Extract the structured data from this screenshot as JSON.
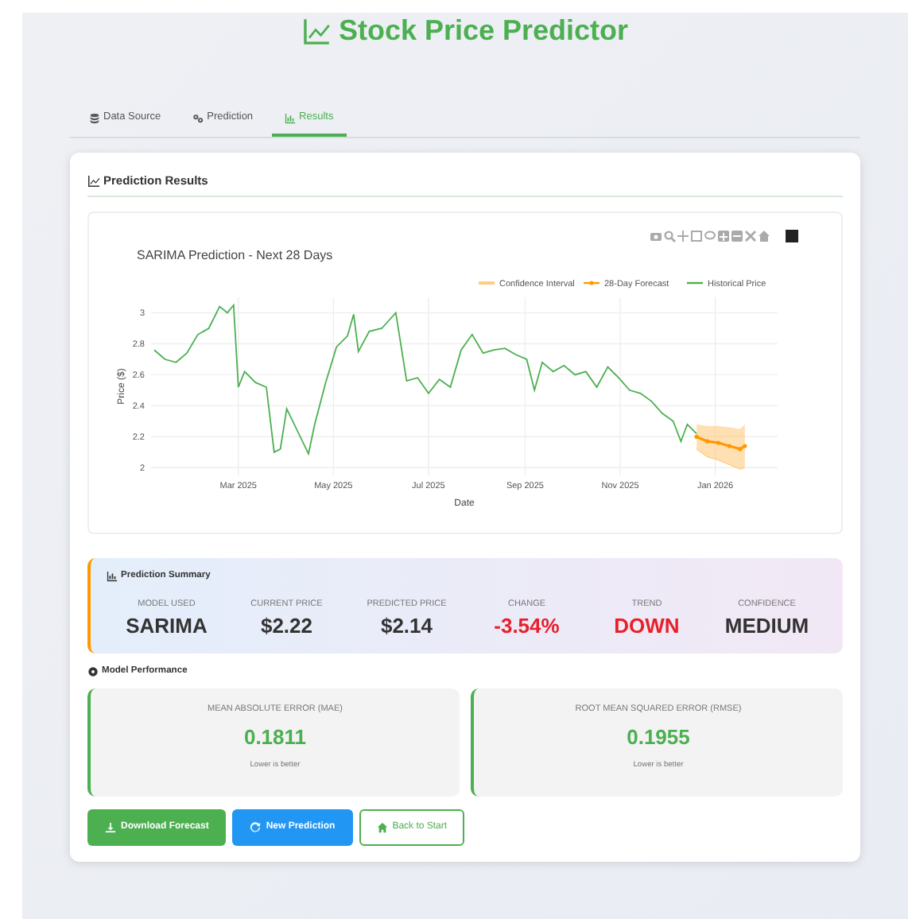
{
  "app_title": "Stock Price Predictor",
  "tabs": [
    {
      "label": "Data Source",
      "selected": false
    },
    {
      "label": "Prediction",
      "selected": false
    },
    {
      "label": "Results",
      "selected": true
    }
  ],
  "results_card": {
    "title": "Prediction Results",
    "chart_data": {
      "type": "line",
      "title": "SARIMA Prediction - Next 28 Days",
      "xlabel": "Date",
      "ylabel": "Price ($)",
      "x": [
        "2025-01-06",
        "2025-01-13",
        "2025-01-20",
        "2025-01-27",
        "2025-02-03",
        "2025-02-10",
        "2025-02-17",
        "2025-02-22",
        "2025-02-26",
        "2025-03-01",
        "2025-03-05",
        "2025-03-12",
        "2025-03-19",
        "2025-03-24",
        "2025-03-28",
        "2025-04-01",
        "2025-04-15",
        "2025-04-19",
        "2025-04-26",
        "2025-05-03",
        "2025-05-10",
        "2025-05-14",
        "2025-05-17",
        "2025-05-24",
        "2025-06-01",
        "2025-06-10",
        "2025-06-17",
        "2025-06-24",
        "2025-07-01",
        "2025-07-08",
        "2025-07-15",
        "2025-07-22",
        "2025-07-29",
        "2025-08-05",
        "2025-08-12",
        "2025-08-19",
        "2025-08-26",
        "2025-09-02",
        "2025-09-07",
        "2025-09-12",
        "2025-09-19",
        "2025-09-26",
        "2025-10-03",
        "2025-10-10",
        "2025-10-17",
        "2025-10-24",
        "2025-10-31",
        "2025-11-07",
        "2025-11-14",
        "2025-11-21",
        "2025-11-28",
        "2025-12-05",
        "2025-12-10",
        "2025-12-14",
        "2025-12-20",
        "2025-12-27",
        "2026-01-03",
        "2026-01-10",
        "2026-01-17",
        "2026-01-20"
      ],
      "xlim": [
        "2025-01-04",
        "2026-02-10"
      ],
      "ylim": [
        1.95,
        3.1
      ],
      "xticks": [
        {
          "value": "2025-03-01",
          "label": "Mar 2025"
        },
        {
          "value": "2025-05-01",
          "label": "May 2025"
        },
        {
          "value": "2025-07-01",
          "label": "Jul 2025"
        },
        {
          "value": "2025-09-01",
          "label": "Sep 2025"
        },
        {
          "value": "2025-11-01",
          "label": "Nov 2025"
        },
        {
          "value": "2026-01-01",
          "label": "Jan 2026"
        }
      ],
      "yticks": [
        2,
        2.2,
        2.4,
        2.6,
        2.8,
        3
      ],
      "grid": true,
      "legend": "top-right",
      "series": [
        {
          "name": "Confidence Interval",
          "type": "area",
          "color": "#ffcc80",
          "values": [
            null,
            null,
            null,
            null,
            null,
            null,
            null,
            null,
            null,
            null,
            null,
            null,
            null,
            null,
            null,
            null,
            null,
            null,
            null,
            null,
            null,
            null,
            null,
            null,
            null,
            null,
            null,
            null,
            null,
            null,
            null,
            null,
            null,
            null,
            null,
            null,
            null,
            null,
            null,
            null,
            null,
            null,
            null,
            null,
            null,
            null,
            null,
            null,
            null,
            null,
            null,
            null,
            null,
            null,
            2.28,
            2.27,
            2.27,
            2.26,
            2.25,
            2.28
          ]
        },
        {
          "type": "line",
          "color": "#ffcc80",
          "values": [
            null,
            null,
            null,
            null,
            null,
            null,
            null,
            null,
            null,
            null,
            null,
            null,
            null,
            null,
            null,
            null,
            null,
            null,
            null,
            null,
            null,
            null,
            null,
            null,
            null,
            null,
            null,
            null,
            null,
            null,
            null,
            null,
            null,
            null,
            null,
            null,
            null,
            null,
            null,
            null,
            null,
            null,
            null,
            null,
            null,
            null,
            null,
            null,
            null,
            null,
            null,
            null,
            null,
            null,
            2.12,
            2.07,
            2.05,
            2.02,
            1.99,
            2.0
          ]
        },
        {
          "name": "28-Day Forecast",
          "type": "line",
          "color": "#ff9800",
          "values": [
            null,
            null,
            null,
            null,
            null,
            null,
            null,
            null,
            null,
            null,
            null,
            null,
            null,
            null,
            null,
            null,
            null,
            null,
            null,
            null,
            null,
            null,
            null,
            null,
            null,
            null,
            null,
            null,
            null,
            null,
            null,
            null,
            null,
            null,
            null,
            null,
            null,
            null,
            null,
            null,
            null,
            null,
            null,
            null,
            null,
            null,
            null,
            null,
            null,
            null,
            null,
            null,
            null,
            null,
            2.2,
            2.17,
            2.16,
            2.14,
            2.12,
            2.14
          ]
        },
        {
          "name": "Historical Price",
          "type": "line",
          "color": "#4caf50",
          "values": [
            2.76,
            2.7,
            2.68,
            2.74,
            2.86,
            2.9,
            3.04,
            3.0,
            3.05,
            2.52,
            2.62,
            2.55,
            2.52,
            2.1,
            2.12,
            2.38,
            2.09,
            2.28,
            2.55,
            2.78,
            2.85,
            2.99,
            2.75,
            2.88,
            2.9,
            3.0,
            2.56,
            2.58,
            2.48,
            2.57,
            2.52,
            2.76,
            2.86,
            2.74,
            2.76,
            2.77,
            2.73,
            2.7,
            2.5,
            2.68,
            2.62,
            2.66,
            2.6,
            2.62,
            2.52,
            2.65,
            2.58,
            2.5,
            2.48,
            2.43,
            2.35,
            2.3,
            2.17,
            2.28,
            2.22,
            null,
            null,
            null,
            null,
            null
          ]
        }
      ]
    }
  },
  "summary": {
    "title": "Prediction Summary",
    "items": [
      {
        "label": "MODEL USED",
        "value": "SARIMA",
        "color": "#333333"
      },
      {
        "label": "CURRENT PRICE",
        "value": "$2.22",
        "color": "#333333"
      },
      {
        "label": "PREDICTED PRICE",
        "value": "$2.14",
        "color": "#333333"
      },
      {
        "label": "CHANGE",
        "value": "-3.54%",
        "color": "#e8202a"
      },
      {
        "label": "TREND",
        "value": "DOWN",
        "color": "#e8202a"
      },
      {
        "label": "CONFIDENCE",
        "value": "MEDIUM",
        "color": "#333333"
      }
    ]
  },
  "performance": {
    "title": "Model Performance",
    "metrics": [
      {
        "label": "MEAN ABSOLUTE ERROR (MAE)",
        "value": "0.1811",
        "note": "Lower is better"
      },
      {
        "label": "ROOT MEAN SQUARED ERROR (RMSE)",
        "value": "0.1955",
        "note": "Lower is better"
      }
    ]
  },
  "buttons": [
    {
      "label": "Download Forecast",
      "kind": "download"
    },
    {
      "label": "New Prediction",
      "kind": "new"
    },
    {
      "label": "Back to Start",
      "kind": "back"
    }
  ]
}
